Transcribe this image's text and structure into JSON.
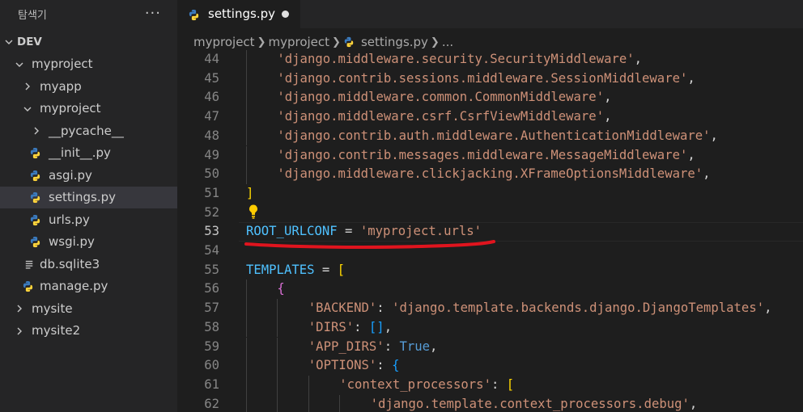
{
  "explorer": {
    "title": "탐색기",
    "more_label": "···",
    "items": [
      {
        "label": "DEV",
        "type": "root",
        "expanded": true
      },
      {
        "label": "myproject",
        "type": "folder",
        "expanded": true
      },
      {
        "label": "myapp",
        "type": "folder",
        "expanded": false
      },
      {
        "label": "myproject",
        "type": "folder",
        "expanded": true
      },
      {
        "label": "__pycache__",
        "type": "folder",
        "expanded": false
      },
      {
        "label": "__init__.py",
        "type": "python"
      },
      {
        "label": "asgi.py",
        "type": "python"
      },
      {
        "label": "settings.py",
        "type": "python",
        "active": true
      },
      {
        "label": "urls.py",
        "type": "python"
      },
      {
        "label": "wsgi.py",
        "type": "python"
      },
      {
        "label": "db.sqlite3",
        "type": "file"
      },
      {
        "label": "manage.py",
        "type": "python"
      },
      {
        "label": "mysite",
        "type": "folder",
        "expanded": false
      },
      {
        "label": "mysite2",
        "type": "folder",
        "expanded": false
      }
    ]
  },
  "tab": {
    "label": "settings.py",
    "unsaved": true
  },
  "breadcrumb": {
    "parts": [
      "myproject",
      "myproject",
      "settings.py",
      "..."
    ]
  },
  "editor": {
    "current_line": "53",
    "lines": [
      {
        "n": "44",
        "indent": 1,
        "tokens": [
          {
            "t": "'django.middleware.security.SecurityMiddleware'",
            "c": "s"
          },
          {
            "t": ",",
            "c": "p"
          }
        ]
      },
      {
        "n": "45",
        "indent": 1,
        "tokens": [
          {
            "t": "'django.contrib.sessions.middleware.SessionMiddleware'",
            "c": "s"
          },
          {
            "t": ",",
            "c": "p"
          }
        ]
      },
      {
        "n": "46",
        "indent": 1,
        "tokens": [
          {
            "t": "'django.middleware.common.CommonMiddleware'",
            "c": "s"
          },
          {
            "t": ",",
            "c": "p"
          }
        ]
      },
      {
        "n": "47",
        "indent": 1,
        "tokens": [
          {
            "t": "'django.middleware.csrf.CsrfViewMiddleware'",
            "c": "s"
          },
          {
            "t": ",",
            "c": "p"
          }
        ]
      },
      {
        "n": "48",
        "indent": 1,
        "tokens": [
          {
            "t": "'django.contrib.auth.middleware.AuthenticationMiddleware'",
            "c": "s"
          },
          {
            "t": ",",
            "c": "p"
          }
        ]
      },
      {
        "n": "49",
        "indent": 1,
        "tokens": [
          {
            "t": "'django.contrib.messages.middleware.MessageMiddleware'",
            "c": "s"
          },
          {
            "t": ",",
            "c": "p"
          }
        ]
      },
      {
        "n": "50",
        "indent": 1,
        "tokens": [
          {
            "t": "'django.middleware.clickjacking.XFrameOptionsMiddleware'",
            "c": "s"
          },
          {
            "t": ",",
            "c": "p"
          }
        ]
      },
      {
        "n": "51",
        "indent": 0,
        "tokens": [
          {
            "t": "]",
            "c": "b1"
          }
        ]
      },
      {
        "n": "52",
        "indent": 0,
        "tokens": []
      },
      {
        "n": "53",
        "indent": 0,
        "tokens": [
          {
            "t": "ROOT_URLCONF",
            "c": "v"
          },
          {
            "t": " = ",
            "c": "p"
          },
          {
            "t": "'myproject.urls'",
            "c": "s"
          }
        ]
      },
      {
        "n": "54",
        "indent": 0,
        "tokens": []
      },
      {
        "n": "55",
        "indent": 0,
        "tokens": [
          {
            "t": "TEMPLATES",
            "c": "v"
          },
          {
            "t": " = ",
            "c": "p"
          },
          {
            "t": "[",
            "c": "b1"
          }
        ]
      },
      {
        "n": "56",
        "indent": 1,
        "tokens": [
          {
            "t": "{",
            "c": "b2"
          }
        ]
      },
      {
        "n": "57",
        "indent": 2,
        "tokens": [
          {
            "t": "'BACKEND'",
            "c": "s"
          },
          {
            "t": ": ",
            "c": "p"
          },
          {
            "t": "'django.template.backends.django.DjangoTemplates'",
            "c": "s"
          },
          {
            "t": ",",
            "c": "p"
          }
        ]
      },
      {
        "n": "58",
        "indent": 2,
        "tokens": [
          {
            "t": "'DIRS'",
            "c": "s"
          },
          {
            "t": ": ",
            "c": "p"
          },
          {
            "t": "[]",
            "c": "b3"
          },
          {
            "t": ",",
            "c": "p"
          }
        ]
      },
      {
        "n": "59",
        "indent": 2,
        "tokens": [
          {
            "t": "'APP_DIRS'",
            "c": "s"
          },
          {
            "t": ": ",
            "c": "p"
          },
          {
            "t": "True",
            "c": "k"
          },
          {
            "t": ",",
            "c": "p"
          }
        ]
      },
      {
        "n": "60",
        "indent": 2,
        "tokens": [
          {
            "t": "'OPTIONS'",
            "c": "s"
          },
          {
            "t": ": ",
            "c": "p"
          },
          {
            "t": "{",
            "c": "b3"
          }
        ]
      },
      {
        "n": "61",
        "indent": 3,
        "tokens": [
          {
            "t": "'context_processors'",
            "c": "s"
          },
          {
            "t": ": ",
            "c": "p"
          },
          {
            "t": "[",
            "c": "b1"
          }
        ]
      },
      {
        "n": "62",
        "indent": 4,
        "tokens": [
          {
            "t": "'django.template.context_processors.debug'",
            "c": "s"
          },
          {
            "t": ",",
            "c": "p"
          }
        ]
      }
    ]
  },
  "colors": {
    "python_icon_blue": "#3b7bbf",
    "python_icon_yellow": "#ffd43b",
    "annotation_underline": "#e0141e",
    "lightbulb": "#ffcc00"
  },
  "icons": {
    "python_file": "python-icon",
    "plain_file": "file-lines-icon",
    "chevron_open": "chevron-down-icon",
    "chevron_closed": "chevron-right-icon",
    "quick_fix": "lightbulb-icon"
  }
}
